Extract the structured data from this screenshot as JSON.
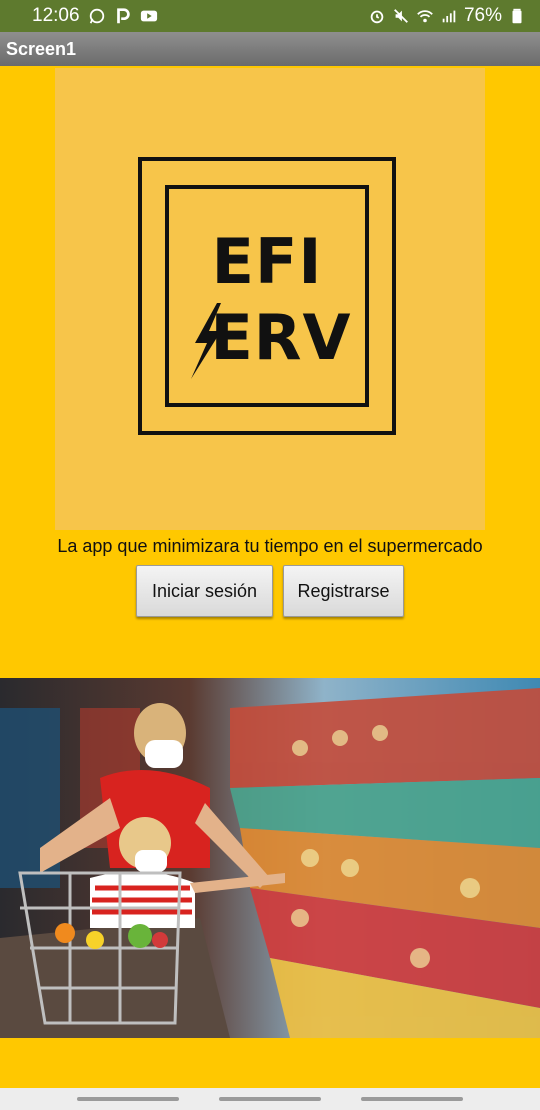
{
  "status_bar": {
    "time": "12:06",
    "battery": "76%",
    "left_icons": [
      "whatsapp-icon",
      "parking-icon",
      "youtube-icon"
    ],
    "right_icons": [
      "alarm-icon",
      "mute-icon",
      "wifi-icon",
      "signal-icon",
      "battery-icon"
    ]
  },
  "title_bar": {
    "title": "Screen1"
  },
  "logo": {
    "line1": "EFI",
    "line2": "ERV"
  },
  "main": {
    "tagline": "La app que minimizara tu tiempo en el supermercado",
    "login_button": "Iniciar sesión",
    "register_button": "Registrarse"
  },
  "colors": {
    "background": "#FFC800",
    "logo_panel": "#F7C54A",
    "status_bar": "#5E7A2E",
    "title_bar": "#7A7A7A"
  }
}
